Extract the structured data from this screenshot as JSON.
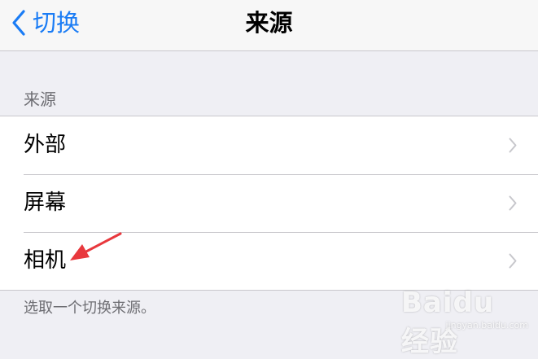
{
  "navbar": {
    "back_label": "切换",
    "title": "来源"
  },
  "section": {
    "header": "来源",
    "items": [
      {
        "label": "外部"
      },
      {
        "label": "屏幕"
      },
      {
        "label": "相机"
      }
    ],
    "footer": "选取一个切换来源。"
  },
  "watermark": {
    "text": "Baidu 经验",
    "sub": "jingyan.baidu.com"
  },
  "colors": {
    "accent": "#1a7cf5",
    "background": "#efeff4",
    "annotation_arrow": "#e8383d"
  }
}
